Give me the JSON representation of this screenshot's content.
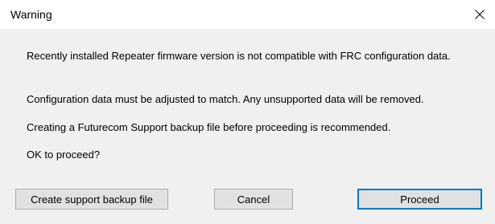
{
  "window": {
    "title": "Warning",
    "close_icon": "close-icon"
  },
  "messages": {
    "line1": "Recently installed Repeater firmware version is not compatible with FRC configuration data.",
    "line2": "Configuration data must be adjusted to match. Any unsupported data will be removed.",
    "line3": "Creating a Futurecom Support backup file before proceeding is recommended.",
    "line4": "OK to proceed?"
  },
  "buttons": {
    "backup_label": "Create support backup file",
    "cancel_label": "Cancel",
    "proceed_label": "Proceed",
    "default": "Proceed"
  },
  "colors": {
    "dialog_bg": "#f0f0f0",
    "titlebar_bg": "#ffffff",
    "button_bg": "#e1e1e1",
    "button_border": "#adadad",
    "default_button_border": "#0078d7"
  }
}
